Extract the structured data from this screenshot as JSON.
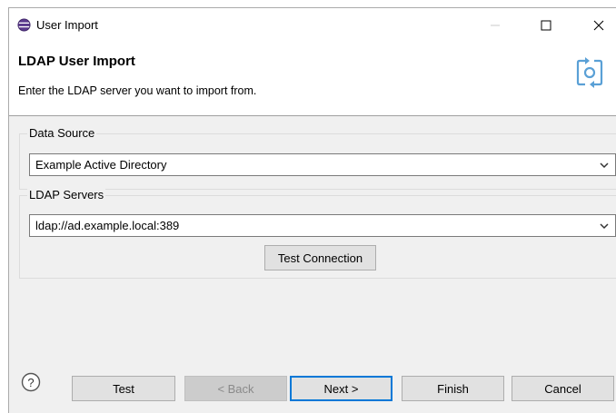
{
  "window": {
    "title": "User Import"
  },
  "header": {
    "title": "LDAP User Import",
    "description": "Enter the LDAP server you want to import from."
  },
  "data_source": {
    "label": "Data Source",
    "selected": "Example Active Directory"
  },
  "ldap_servers": {
    "label": "LDAP Servers",
    "selected": "ldap://ad.example.local:389",
    "test_connection_label": "Test Connection"
  },
  "footer": {
    "test_label": "Test",
    "back_label": "< Back",
    "next_label": "Next >",
    "finish_label": "Finish",
    "cancel_label": "Cancel"
  },
  "colors": {
    "accent": "#0078d7",
    "dialog_bg": "#f0f0f0",
    "title_icon": "#6b3fa0"
  }
}
